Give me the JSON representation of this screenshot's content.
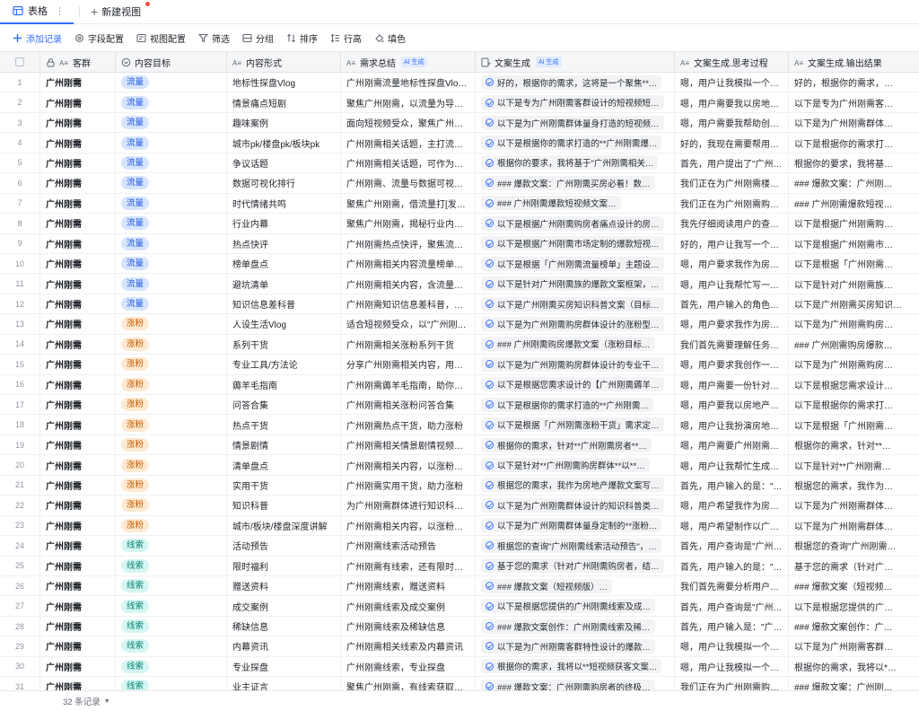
{
  "tabs": {
    "active_label": "表格",
    "new_view_label": "新建视图"
  },
  "toolbar": {
    "add_record": "添加记录",
    "field_config": "字段配置",
    "view_config": "视图配置",
    "filter": "筛选",
    "group": "分组",
    "sort": "排序",
    "row_height": "行高",
    "fill_color": "填色"
  },
  "columns": {
    "c1": "客群",
    "c2": "内容目标",
    "c3": "内容形式",
    "c4": "需求总结",
    "c5": "文案生成",
    "c6": "文案生成.思考过程",
    "c7": "文案生成.输出结果",
    "ai_badge": "AI 生成"
  },
  "rows": [
    {
      "n": "1",
      "g": "广州刚需",
      "t": "流量",
      "tt": "flow",
      "f": "地标性探盘Vlog",
      "s": "广州刚需流量地标性探盘Vlog…",
      "w": "好的，根据你的需求，这将是一个聚焦**…",
      "p": "嗯，用户让我模拟一个…",
      "o": "好的，根据你的需求，…"
    },
    {
      "n": "2",
      "g": "广州刚需",
      "t": "流量",
      "tt": "flow",
      "f": "情景痛点短剧",
      "s": "聚焦广州刚需，以流量为导向…",
      "w": "以下是专为广州刚需客群设计的短视频短…",
      "p": "嗯，用户需要我以房地…",
      "o": "以下是专为广州刚需客…"
    },
    {
      "n": "3",
      "g": "广州刚需",
      "t": "流量",
      "tt": "flow",
      "f": "趣味案例",
      "s": "面向短视频受众，聚焦广州刚…",
      "w": "以下是为广州刚需群体量身打造的短视频…",
      "p": "嗯，用户需要我帮助创…",
      "o": "以下是为广州刚需群体…"
    },
    {
      "n": "4",
      "g": "广州刚需",
      "t": "流量",
      "tt": "flow",
      "f": "城市pk/楼盘pk/板块pk",
      "s": "广州刚需相关话题，主打流量…",
      "w": "以下是根据你的需求打造的**广州刚需爆…",
      "p": "好的，我现在需要帮用…",
      "o": "以下是根据你的需求打…"
    },
    {
      "n": "5",
      "g": "广州刚需",
      "t": "流量",
      "tt": "flow",
      "f": "争议话题",
      "s": "广州刚需相关话题，可作为吸…",
      "w": "根据你的要求，我将基于\"广州刚需相关…",
      "p": "首先，用户提出了\"广州…",
      "o": "根据你的要求，我将基…"
    },
    {
      "n": "6",
      "g": "广州刚需",
      "t": "流量",
      "tt": "flow",
      "f": "数据可视化排行",
      "s": "广州刚需、流量与数据可视化…",
      "w": "### 爆款文案：广州刚需买房必看！数…",
      "p": "我们正在为广州刚需楼…",
      "o": "### 爆款文案：广州刚…"
    },
    {
      "n": "7",
      "g": "广州刚需",
      "t": "流量",
      "tt": "flow",
      "f": "时代情绪共鸣",
      "s": "聚焦广州刚需，借流量打[发时…",
      "w": "### 广州刚需爆款短视频文案…",
      "p": "我们正在为广州刚需购…",
      "o": "### 广州刚需爆款短视…"
    },
    {
      "n": "8",
      "g": "广州刚需",
      "t": "流量",
      "tt": "flow",
      "f": "行业内幕",
      "s": "聚焦广州刚需，揭秘行业内幕…",
      "w": "以下是根据广州刚需购房者痛点设计的房…",
      "p": "我先仔细阅读用户的查…",
      "o": "以下是根据广州刚需购…"
    },
    {
      "n": "9",
      "g": "广州刚需",
      "t": "流量",
      "tt": "flow",
      "f": "热点快评",
      "s": "广州刚需热点快评，聚焦流量…",
      "w": "以下是根据广州刚需市场定制的爆款短视…",
      "p": "好的，用户让我写一个…",
      "o": "以下是根据广州刚需市…"
    },
    {
      "n": "10",
      "g": "广州刚需",
      "t": "流量",
      "tt": "flow",
      "f": "榜单盘点",
      "s": "广州刚需相关内容流量榜单盘…",
      "w": "以下是根据「广州刚需流量榜单」主题设…",
      "p": "嗯，用户要求我作为房…",
      "o": "以下是根据「广州刚需…"
    },
    {
      "n": "11",
      "g": "广州刚需",
      "t": "流量",
      "tt": "flow",
      "f": "避坑清单",
      "s": "广州刚需相关内容，含流量信…",
      "w": "以下是针对广州刚需族的爆款文案框架，…",
      "p": "嗯，用户让我帮忙写一…",
      "o": "以下是针对广州刚需族…"
    },
    {
      "n": "12",
      "g": "广州刚需",
      "t": "流量",
      "tt": "flow",
      "f": "知识信息差科普",
      "s": "广州刚需知识信息差科普，助…",
      "w": "以下是广州刚需买房知识科普文案（目标…",
      "p": "首先，用户输入的角色…",
      "o": "以下是广州刚需买房知识…"
    },
    {
      "n": "13",
      "g": "广州刚需",
      "t": "涨粉",
      "tt": "fans",
      "f": "人设生活Vlog",
      "s": "适合短视频受众，以\"广州刚…",
      "w": "以下是为广州刚需购房群体设计的涨粉型…",
      "p": "嗯，用户要求我作为房…",
      "o": "以下是为广州刚需购房…"
    },
    {
      "n": "14",
      "g": "广州刚需",
      "t": "涨粉",
      "tt": "fans",
      "f": "系列干货",
      "s": "广州刚需相关涨粉系列干货",
      "w": "### 广州刚需购房爆款文案（涨粉目标…",
      "p": "我们首先需要理解任务…",
      "o": "### 广州刚需购房爆款…"
    },
    {
      "n": "15",
      "g": "广州刚需",
      "t": "涨粉",
      "tt": "fans",
      "f": "专业工具/方法论",
      "s": "分享广州刚需相关内容，用专…",
      "w": "以下是为广州刚需购房群体设计的专业干…",
      "p": "嗯，用户要求我创作一…",
      "o": "以下是为广州刚需购房…"
    },
    {
      "n": "16",
      "g": "广州刚需",
      "t": "涨粉",
      "tt": "fans",
      "f": "薅羊毛指南",
      "s": "广州刚需薅羊毛指南，助你涨…",
      "w": "以下是根据您需求设计的【广州刚需薅羊…",
      "p": "嗯，用户需要一份针对…",
      "o": "以下是根据您需求设计…"
    },
    {
      "n": "17",
      "g": "广州刚需",
      "t": "涨粉",
      "tt": "fans",
      "f": "问答合集",
      "s": "广州刚需相关涨粉问答合集",
      "w": "以下是根据你的需求打造的**广州刚需…",
      "p": "嗯，用户要我以房地产…",
      "o": "以下是根据你的需求打…"
    },
    {
      "n": "18",
      "g": "广州刚需",
      "t": "涨粉",
      "tt": "fans",
      "f": "热点干货",
      "s": "广州刚需热点干货，助力涨粉",
      "w": "以下是根据「广州刚需涨粉干货」需求定…",
      "p": "嗯，用户让我扮演房地…",
      "o": "以下是根据「广州刚需…"
    },
    {
      "n": "19",
      "g": "广州刚需",
      "t": "涨粉",
      "tt": "fans",
      "f": "情景剧情",
      "s": "广州刚需相关情景剧情视频，…",
      "w": "根据你的需求，针对**广州刚需房者**…",
      "p": "嗯，用户需要广州刚需…",
      "o": "根据你的需求，针对**…"
    },
    {
      "n": "20",
      "g": "广州刚需",
      "t": "涨粉",
      "tt": "fans",
      "f": "清单盘点",
      "s": "广州刚需相关内容，以涨粉为…",
      "w": "以下是针对**广州刚需购房群体**以**…",
      "p": "嗯，用户让我帮忙生成…",
      "o": "以下是针对**广州刚需…"
    },
    {
      "n": "21",
      "g": "广州刚需",
      "t": "涨粉",
      "tt": "fans",
      "f": "实用干货",
      "s": "广州刚需实用干货，助力涨粉",
      "w": "根据您的需求，我作为房地产爆款文案写…",
      "p": "首先，用户输入的是：\"…",
      "o": "根据您的需求，我作为…"
    },
    {
      "n": "22",
      "g": "广州刚需",
      "t": "涨粉",
      "tt": "fans",
      "f": "知识科普",
      "s": "为广州刚需群体进行知识科普…",
      "w": "以下是为广州刚需群体设计的知识科普类…",
      "p": "嗯，用户希望我作为房…",
      "o": "以下是为广州刚需群体…"
    },
    {
      "n": "23",
      "g": "广州刚需",
      "t": "涨粉",
      "tt": "fans",
      "f": "城市/板块/楼盘深度讲解",
      "s": "广州刚需相关内容，以涨粉为…",
      "w": "以下是为广州刚需群体量身定制的**涨粉…",
      "p": "嗯，用户希望制作以广…",
      "o": "以下是为广州刚需群体…"
    },
    {
      "n": "24",
      "g": "广州刚需",
      "t": "线索",
      "tt": "lead",
      "f": "活动预告",
      "s": "广州刚需线索活动预告",
      "w": "根据您的查询\"广州刚需线索活动预告\"，…",
      "p": "首先，用户查询是\"广州…",
      "o": "根据您的查询\"广州刚需…"
    },
    {
      "n": "25",
      "g": "广州刚需",
      "t": "线索",
      "tt": "lead",
      "f": "限时福利",
      "s": "广州刚需有线索，还有限时福…",
      "w": "基于您的需求（针对广州刚需购房者，结…",
      "p": "首先，用户输入的是：\"…",
      "o": "基于您的需求（针对广…"
    },
    {
      "n": "26",
      "g": "广州刚需",
      "t": "线索",
      "tt": "lead",
      "f": "赠送资料",
      "s": "广州刚需线索，赠送资料",
      "w": "### 爆款文案（短视频版）…",
      "p": "我们首先需要分析用户…",
      "o": "### 爆款文案（短视频…"
    },
    {
      "n": "27",
      "g": "广州刚需",
      "t": "线索",
      "tt": "lead",
      "f": "成交案例",
      "s": "广州刚需线索及成交案例",
      "w": "以下是根据您提供的广州刚需线索及成…",
      "p": "首先，用户查询是\"广州…",
      "o": "以下是根据您提供的广…"
    },
    {
      "n": "28",
      "g": "广州刚需",
      "t": "线索",
      "tt": "lead",
      "f": "稀缺信息",
      "s": "广州刚需线索及稀缺信息",
      "w": "### 爆款文案创作：广州刚需线索及稀…",
      "p": "首先，用户输入是：\"广…",
      "o": "### 爆款文案创作：广…"
    },
    {
      "n": "29",
      "g": "广州刚需",
      "t": "线索",
      "tt": "lead",
      "f": "内幕资讯",
      "s": "广州刚需相关线索及内幕资讯",
      "w": "以下是为广州刚需客群特性设计的爆款…",
      "p": "嗯，用户让我模拟一个…",
      "o": "以下是为广州刚需客群…"
    },
    {
      "n": "30",
      "g": "广州刚需",
      "t": "线索",
      "tt": "lead",
      "f": "专业探盘",
      "s": "广州刚需线索，专业探盘",
      "w": "根据你的需求，我将以**短视频获客文案…",
      "p": "嗯，用户让我模拟一个…",
      "o": "根据你的需求，我将以*…"
    },
    {
      "n": "31",
      "g": "广州刚需",
      "t": "线索",
      "tt": "lead",
      "f": "业主证言",
      "s": "聚焦广州刚需，有线索获取业…",
      "w": "### 爆款文案：广州刚需购房者的终极…",
      "p": "我们正在为广州刚需购…",
      "o": "### 爆款文案：广州刚…"
    }
  ],
  "footer": {
    "record_count": "32 条记录"
  },
  "colors": {
    "accent": "#3370ff",
    "tag_flow": "#d6e4ff",
    "tag_fans": "#feead2",
    "tag_lead": "#d5f6f2"
  }
}
